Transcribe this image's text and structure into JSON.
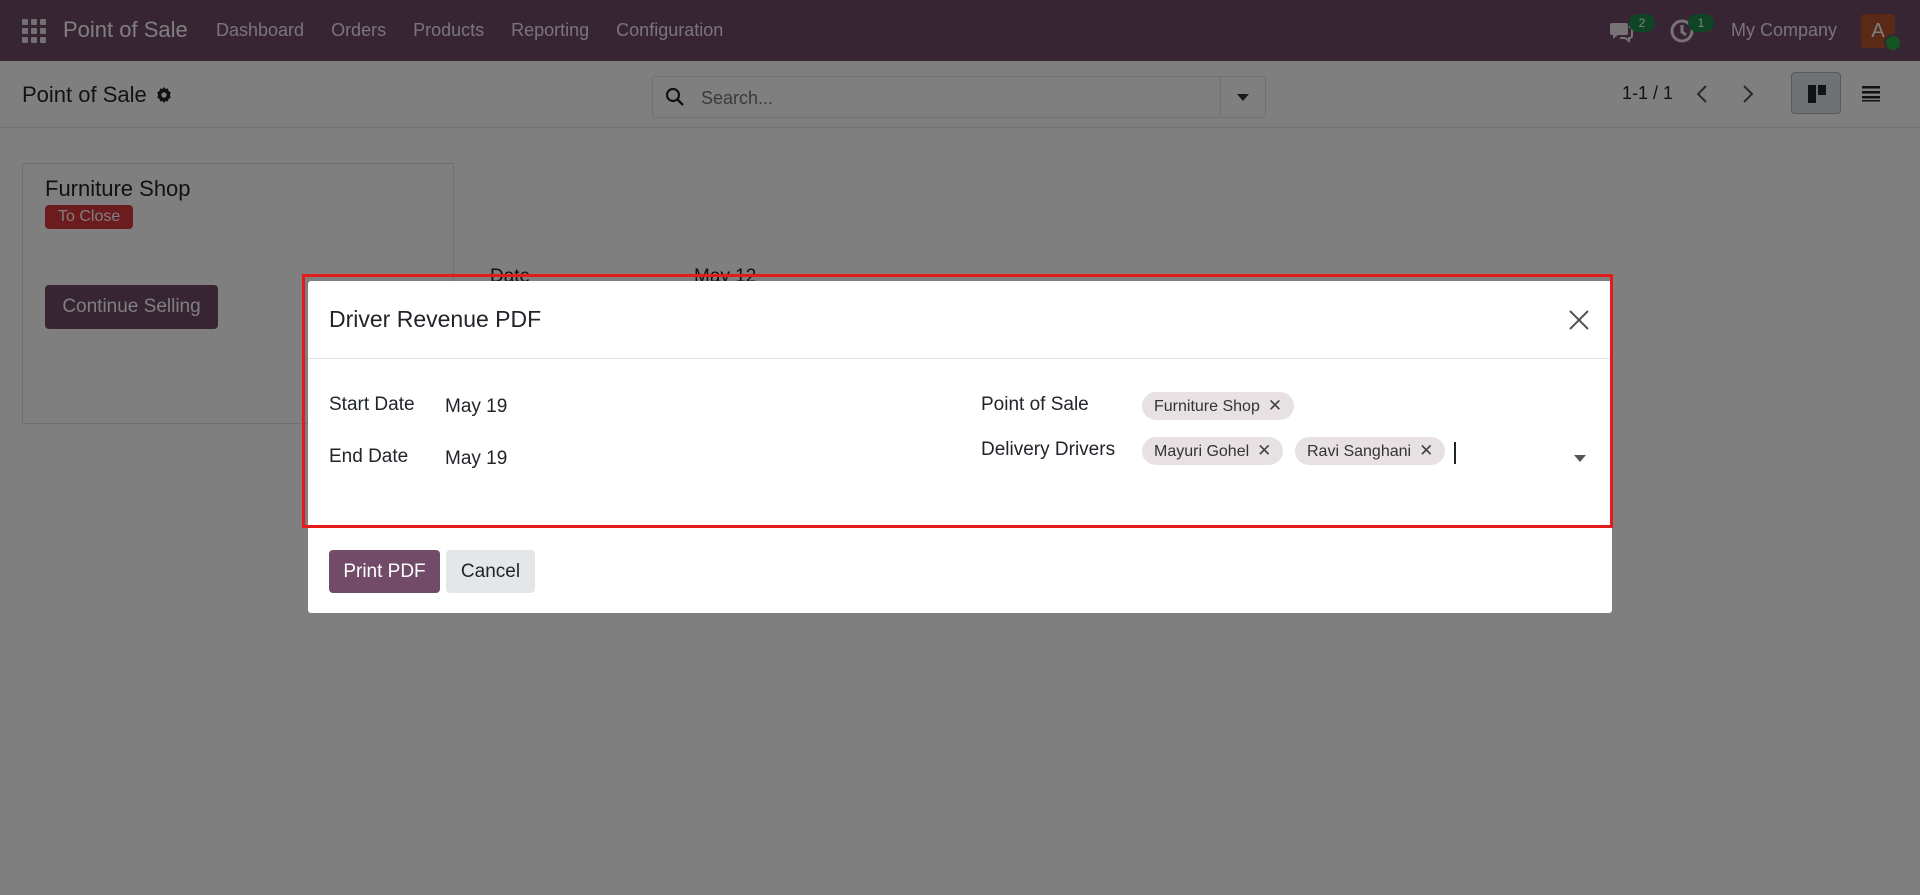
{
  "navbar": {
    "brand": "Point of Sale",
    "menu": [
      "Dashboard",
      "Orders",
      "Products",
      "Reporting",
      "Configuration"
    ],
    "messages_badge": "2",
    "activities_badge": "1",
    "company": "My Company",
    "avatar_initial": "A",
    "bg_color": "#714b67"
  },
  "control_panel": {
    "breadcrumb": "Point of Sale",
    "search_placeholder": "Search...",
    "pager": "1-1 / 1"
  },
  "kanban": {
    "card_title": "Furniture Shop",
    "status_badge": "To Close",
    "continue_label": "Continue Selling",
    "date_label": "Date",
    "date_value": "May 12"
  },
  "modal": {
    "title": "Driver Revenue PDF",
    "start_date_label": "Start Date",
    "start_date_value": "May 19",
    "end_date_label": "End Date",
    "end_date_value": "May 19",
    "pos_label": "Point of Sale",
    "pos_tags": [
      "Furniture Shop"
    ],
    "drivers_label": "Delivery Drivers",
    "driver_tags": [
      "Mayuri Gohel",
      "Ravi Sanghani"
    ],
    "print_label": "Print PDF",
    "cancel_label": "Cancel",
    "highlight_color": "#e31b1b"
  }
}
